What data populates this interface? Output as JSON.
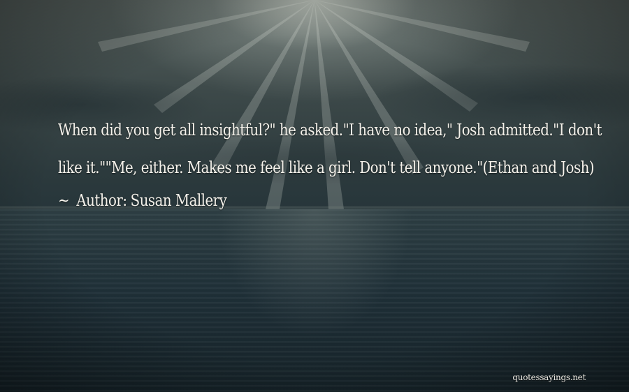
{
  "quote": {
    "text": "When did you get all insightful?\" he asked.\"I have no idea,\" Josh admitted.\"I don't like it.\"\"Me, either. Makes me feel like a girl. Don't tell anyone.\"(Ethan and Josh)",
    "author_prefix_icon": "~",
    "author_label": "Author:",
    "author_name": "Susan Mallery"
  },
  "watermark": {
    "text": "quotessayings.net"
  },
  "background": {
    "scene": "sun-over-sea",
    "sky_color": "#56605d",
    "sea_color": "#1f3038",
    "text_color": "#f4f1ea"
  }
}
